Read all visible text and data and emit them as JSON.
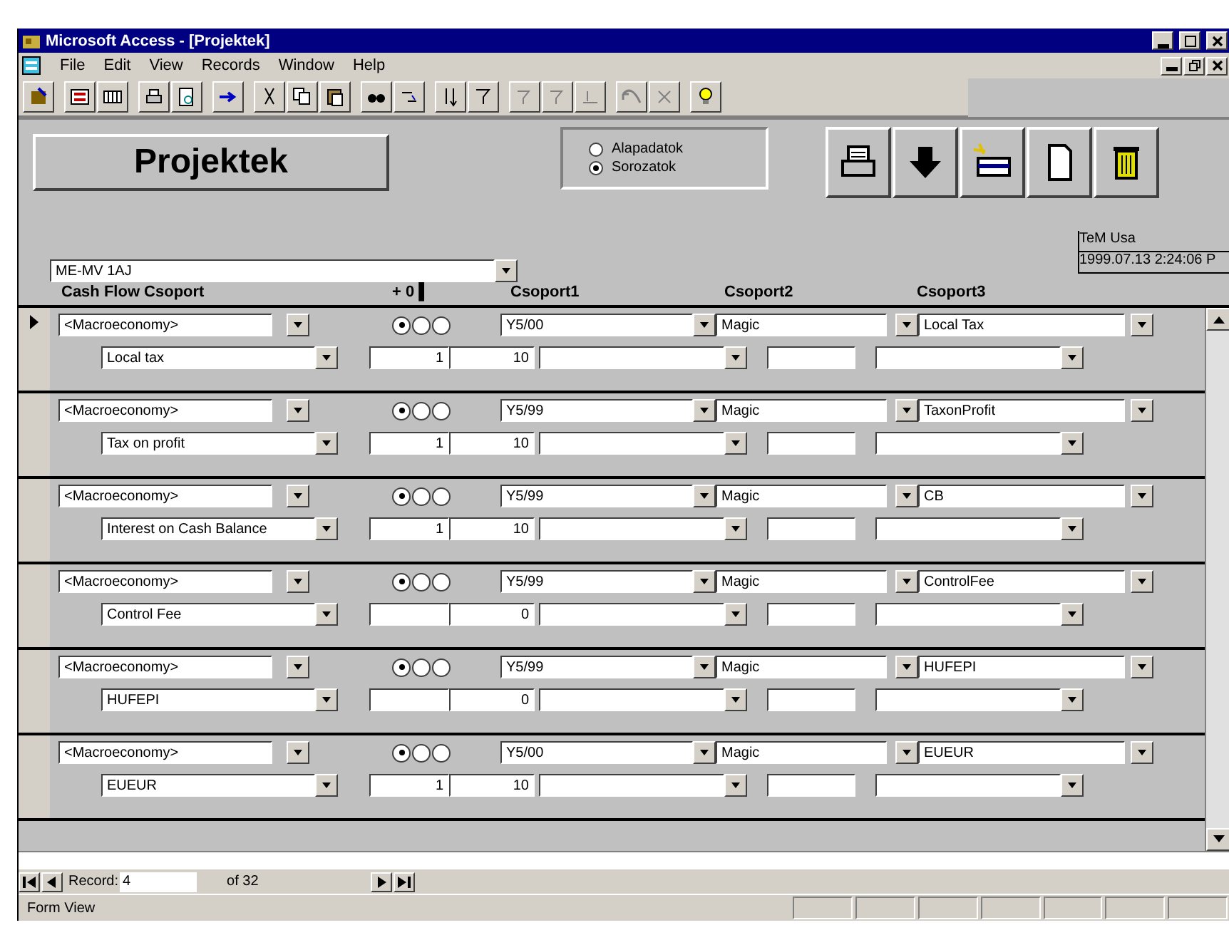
{
  "window": {
    "title": "Microsoft Access - [Projektek]"
  },
  "menu": [
    "File",
    "Edit",
    "View",
    "Records",
    "Window",
    "Help"
  ],
  "form": {
    "title_button": "Projektek",
    "mode_options": [
      {
        "label": "Alapadatok",
        "selected": false
      },
      {
        "label": "Sorozatok",
        "selected": true
      }
    ],
    "project_combo": "ME-MV 1AJ",
    "info_lines": [
      "TeM Usa",
      "1999.07.13 2:24:06 P"
    ],
    "columns": [
      "Cash Flow Csoport",
      "+ 0 ▌",
      "Csoport1",
      "Csoport2",
      "Csoport3"
    ],
    "rows": [
      {
        "current": true,
        "group": "<Macroeconomy>",
        "item": "Local tax",
        "num1": "1",
        "num2": "10",
        "option": [
          {
            "selected": true
          },
          {
            "selected": false
          },
          {
            "selected": false
          }
        ],
        "csoport1": "Y5/00",
        "csoport2": "Magic",
        "csoport3": "Local Tax"
      },
      {
        "current": false,
        "group": "<Macroeconomy>",
        "item": "Tax on profit",
        "num1": "1",
        "num2": "10",
        "option": [
          {
            "selected": true
          },
          {
            "selected": false
          },
          {
            "selected": false
          }
        ],
        "csoport1": "Y5/99",
        "csoport2": "Magic",
        "csoport3": "TaxonProfit"
      },
      {
        "current": false,
        "group": "<Macroeconomy>",
        "item": "Interest on Cash Balance",
        "num1": "1",
        "num2": "10",
        "option": [
          {
            "selected": true
          },
          {
            "selected": false
          },
          {
            "selected": false
          }
        ],
        "csoport1": "Y5/99",
        "csoport2": "Magic",
        "csoport3": "CB"
      },
      {
        "current": false,
        "group": "<Macroeconomy>",
        "item": "Control Fee",
        "num2": "0",
        "option": [
          {
            "selected": true
          },
          {
            "selected": false
          },
          {
            "selected": false
          }
        ],
        "csoport1": "Y5/99",
        "csoport2": "Magic",
        "csoport3": "ControlFee"
      },
      {
        "current": false,
        "group": "<Macroeconomy>",
        "item": "HUFEPI",
        "num2": "0",
        "option": [
          {
            "selected": true
          },
          {
            "selected": false
          },
          {
            "selected": false
          }
        ],
        "csoport1": "Y5/99",
        "csoport2": "Magic",
        "csoport3": "HUFEPI"
      },
      {
        "current": false,
        "group": "<Macroeconomy>",
        "item": "EUEUR",
        "num1": "1",
        "num2": "10",
        "option": [
          {
            "selected": true
          },
          {
            "selected": false
          },
          {
            "selected": false
          }
        ],
        "csoport1": "Y5/00",
        "csoport2": "Magic",
        "csoport3": "EUEUR"
      }
    ]
  },
  "navigator": {
    "label": "Record:",
    "record": "4",
    "total": "of 32"
  },
  "status_bar": "Form View"
}
